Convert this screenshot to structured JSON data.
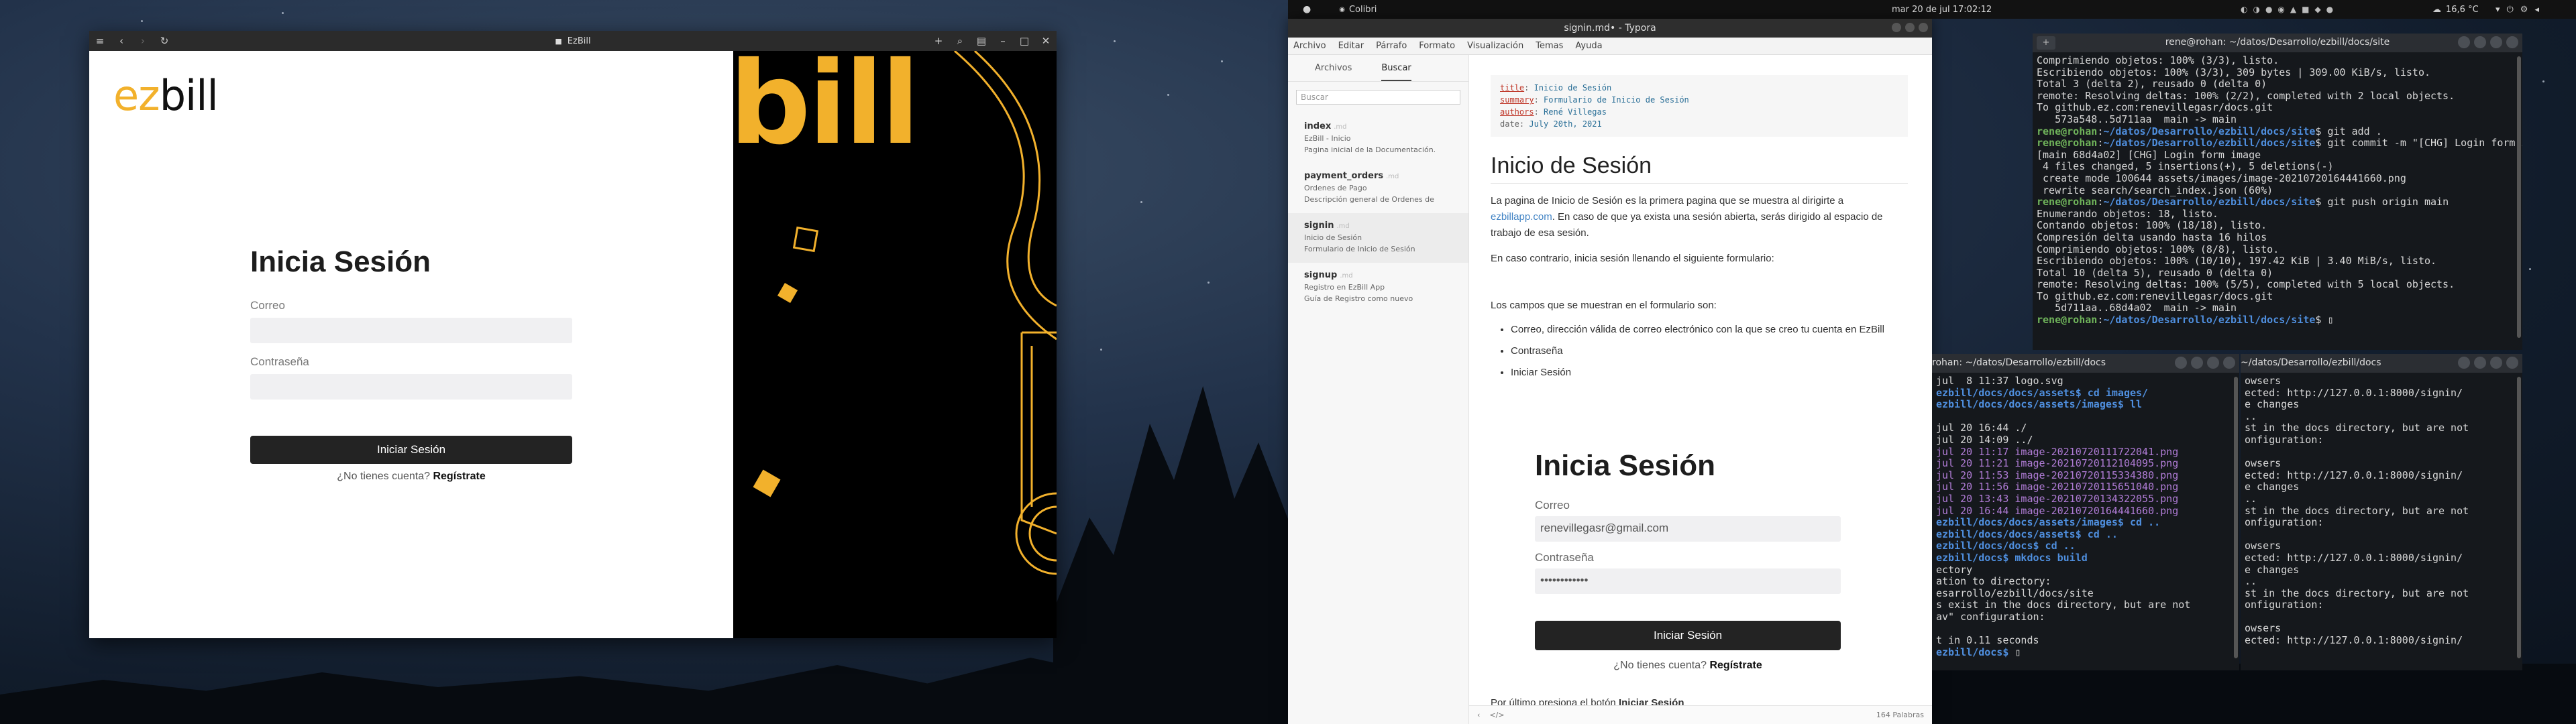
{
  "topbar": {
    "app": "Colibri",
    "clock": "mar 20 de jul  17:02:12",
    "temperature": "16,6 °C"
  },
  "browser": {
    "title": "EzBill",
    "lock_icon": "lock-icon",
    "logo": {
      "ez": "ez",
      "bill": "bill"
    },
    "art_text": "bill",
    "form": {
      "title": "Inicia Sesión",
      "email_label": "Correo",
      "password_label": "Contraseña",
      "submit": "Iniciar Sesión",
      "register_prompt": "¿No tienes cuenta?",
      "register_link": "Regístrate"
    }
  },
  "typora": {
    "title": "signin.md• - Typora",
    "menu": [
      "Archivo",
      "Editar",
      "Párrafo",
      "Formato",
      "Visualización",
      "Temas",
      "Ayuda"
    ],
    "sidebar": {
      "tabs": [
        "Archivos",
        "Buscar"
      ],
      "search_placeholder": "Buscar",
      "items": [
        {
          "name": "index",
          "ext": ".md",
          "line1": "EzBill - Inicio",
          "line2": "Pagina inicial de la Documentación."
        },
        {
          "name": "payment_orders",
          "ext": ".md",
          "line1": "Ordenes de Pago",
          "line2": "Descripción general de Ordenes de"
        },
        {
          "name": "signin",
          "ext": ".md",
          "line1": "Inicio de Sesión",
          "line2": "Formulario de Inicio de Sesión"
        },
        {
          "name": "signup",
          "ext": ".md",
          "line1": "Registro en EzBill App",
          "line2": "Guía de Registro como nuevo"
        }
      ]
    },
    "frontmatter": {
      "title_key": "title",
      "title_val": "Inicio de Sesión",
      "summary_key": "summary",
      "summary_val": "Formulario de Inicio de Sesión",
      "authors_key": "authors",
      "authors_val": "René Villegas",
      "date_key": "date",
      "date_val": "July 20th, 2021"
    },
    "heading": "Inicio de Sesión",
    "p1_a": "La pagina de Inicio de Sesión es la primera pagina que se muestra al dirigirte a ",
    "p1_link": "ezbillapp.com",
    "p1_b": ". En caso de que ya exista una sesión abierta, serás dirigido al espacio de trabajo de esa sesión.",
    "p2": "En caso contrario, inicia sesión llenando el siguiente formulario:",
    "p3": "Los campos que se muestran en el formulario son:",
    "list": [
      "Correo, dirección válida de correo electrónico con la que se creo tu cuenta en EzBill",
      "Contraseña",
      "Iniciar Sesión"
    ],
    "embed": {
      "title": "Inicia Sesión",
      "email_label": "Correo",
      "email_value": "renevillegasr@gmail.com",
      "password_label": "Contraseña",
      "password_value": "••••••••••••",
      "submit": "Iniciar Sesión",
      "register_prompt": "¿No tienes cuenta?",
      "register_link": "Regístrate"
    },
    "footer_text_a": "Por último presiona el botón ",
    "footer_text_b": "Iniciar Sesión",
    "word_count": "164 Palabras"
  },
  "term_top": {
    "title": "rene@rohan: ~/datos/Desarrollo/ezbill/docs/site",
    "lines": [
      "Comprimiendo objetos: 100% (3/3), listo.",
      "Escribiendo objetos: 100% (3/3), 309 bytes | 309.00 KiB/s, listo.",
      "Total 3 (delta 2), reusado 0 (delta 0)",
      "remote: Resolving deltas: 100% (2/2), completed with 2 local objects.",
      "To github.ez.com:renevillegasr/docs.git",
      "   573a548..5d711aa  main -> main"
    ],
    "prompt": "rene@rohan",
    "path": "~/datos/Desarrollo/ezbill/docs/site",
    "cmd1": "$ git add .",
    "cmd2": "$ git commit -m \"[CHG] Login form image\"",
    "out2": [
      "[main 68d4a02] [CHG] Login form image",
      " 4 files changed, 5 insertions(+), 5 deletions(-)",
      " create mode 100644 assets/images/image-20210720164441660.png",
      " rewrite search/search_index.json (60%)"
    ],
    "cmd3": "$ git push origin main",
    "out3": [
      "Enumerando objetos: 18, listo.",
      "Contando objetos: 100% (18/18), listo.",
      "Compresión delta usando hasta 16 hilos",
      "Comprimiendo objetos: 100% (8/8), listo.",
      "Escribiendo objetos: 100% (10/10), 197.42 KiB | 3.40 MiB/s, listo.",
      "Total 10 (delta 5), reusado 0 (delta 0)",
      "remote: Resolving deltas: 100% (5/5), completed with 5 local objects.",
      "To github.ez.com:renevillegasr/docs.git",
      "   5d711aa..68d4a02  main -> main"
    ],
    "cmd4": "$ "
  },
  "term_bl": {
    "title": "rohan: ~/datos/Desarrollo/ezbill/docs",
    "lines": [
      "jul  8 11:37 logo.svg",
      "ezbill/docs/docs/assets$ cd images/",
      "ezbill/docs/docs/assets/images$ ll",
      "",
      "jul 20 16:44 ./",
      "jul 20 14:09 ../",
      "jul 20 11:17 image-20210720111722041.png",
      "jul 20 11:21 image-20210720112104095.png",
      "jul 20 11:53 image-20210720115334380.png",
      "jul 20 11:56 image-20210720115651040.png",
      "jul 20 13:43 image-20210720134322055.png",
      "jul 20 16:44 image-20210720164441660.png",
      "ezbill/docs/docs/assets/images$ cd ..",
      "ezbill/docs/docs/assets$ cd ..",
      "ezbill/docs/docs$ cd ..",
      "ezbill/docs$ mkdocs build",
      "ectory",
      "ation to directory:",
      "esarrollo/ezbill/docs/site",
      "s exist in the docs directory, but are not",
      "av\" configuration:",
      "",
      "t in 0.11 seconds",
      "ezbill/docs$ "
    ]
  },
  "term_br": {
    "title": "~/datos/Desarrollo/ezbill/docs",
    "lines": [
      "owsers",
      "ected: http://127.0.0.1:8000/signin/",
      "e changes",
      "..",
      "st in the docs directory, but are not",
      "onfiguration:",
      "",
      "owsers",
      "ected: http://127.0.0.1:8000/signin/",
      "e changes",
      "..",
      "st in the docs directory, but are not",
      "onfiguration:",
      "",
      "owsers",
      "ected: http://127.0.0.1:8000/signin/",
      "e changes",
      "..",
      "st in the docs directory, but are not",
      "onfiguration:",
      "",
      "owsers",
      "ected: http://127.0.0.1:8000/signin/"
    ]
  }
}
